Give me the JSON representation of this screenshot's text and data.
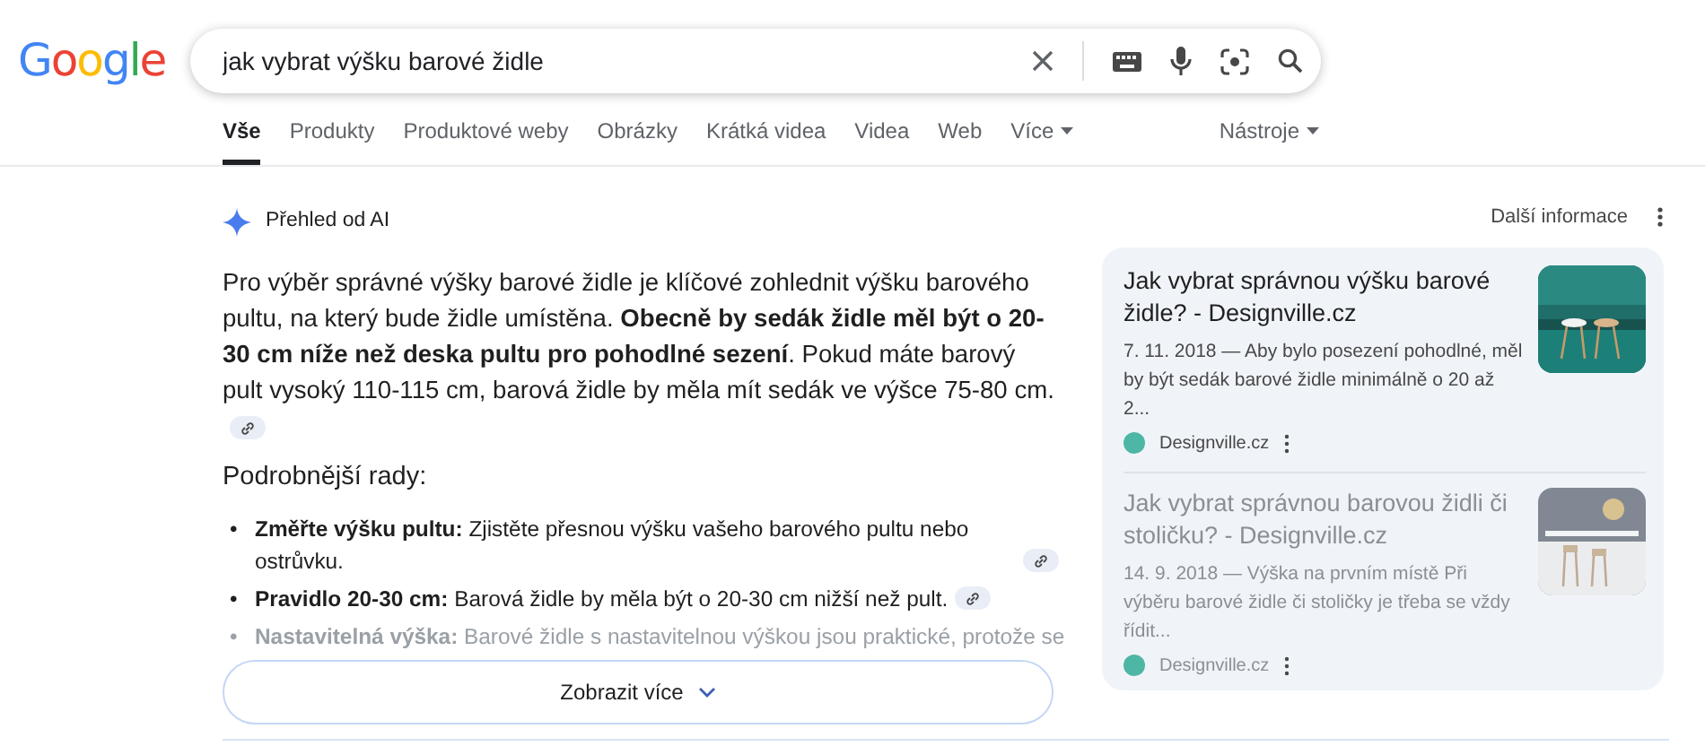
{
  "logo": "Google",
  "search": {
    "value": "jak vybrat výšku barové židle"
  },
  "tabs": [
    {
      "label": "Vše",
      "selected": true,
      "dropdown": false
    },
    {
      "label": "Produkty",
      "selected": false,
      "dropdown": false
    },
    {
      "label": "Produktové weby",
      "selected": false,
      "dropdown": false
    },
    {
      "label": "Obrázky",
      "selected": false,
      "dropdown": false
    },
    {
      "label": "Krátká videa",
      "selected": false,
      "dropdown": false
    },
    {
      "label": "Videa",
      "selected": false,
      "dropdown": false
    },
    {
      "label": "Web",
      "selected": false,
      "dropdown": false
    },
    {
      "label": "Více",
      "selected": false,
      "dropdown": true
    }
  ],
  "tools": "Nástroje",
  "ai_overview": {
    "title": "Přehled od AI",
    "more_info": "Další informace",
    "paragraph": "Pro výběr správné výšky barové židle je klíčové zohlednit výšku barového pultu, na který bude židle umístěna. **Obecně by sedák židle měl být o 20-30 cm níže než deska pultu pro pohodlné sezení**. Pokud máte barový pult vysoký 110-115 cm, barová židle by měla mít sedák ve výšce 75-80 cm.",
    "paragraph_cited": true,
    "heading": "Podrobnější rady:",
    "bullet_marker": "•",
    "bullets": [
      {
        "text": "**Změřte výšku pultu:** Zjistěte přesnou výšku vašeho barového pultu nebo ostrůvku.",
        "cited": true,
        "faded": false
      },
      {
        "text": "**Pravidlo 20-30 cm:** Barová židle by měla být o 20-30 cm nižší než pult.",
        "cited": true,
        "faded": false
      },
      {
        "text": "**Nastavitelná výška:** Barové židle s nastavitelnou výškou jsou praktické, protože se",
        "cited": false,
        "faded": true
      }
    ],
    "show_more": "Zobrazit více",
    "sources": [
      {
        "title": "Jak vybrat správnou výšku barové židle? - Designville.cz",
        "snippet": "7. 11. 2018 — Aby bylo posezení pohodlné, měl by být sedák barové židle minimálně o 20 až 2...",
        "site": "Designville.cz",
        "color": "#4db6a4",
        "faded": false
      },
      {
        "title": "Jak vybrat správnou barovou židli či stoličku? - Designville.cz",
        "snippet": "14. 9. 2018 — Výška na prvním místě Při výběru barové židle či stoličky je třeba se vždy řídit...",
        "site": "Designville.cz",
        "color": "#4db6a4",
        "faded": true
      }
    ]
  }
}
